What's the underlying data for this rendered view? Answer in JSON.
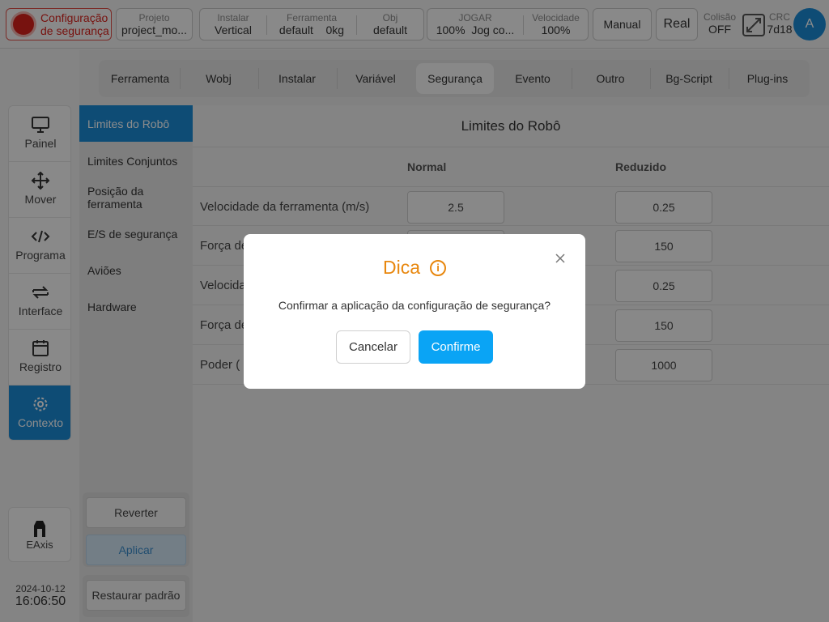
{
  "topbar": {
    "safety": {
      "line1": "Configuração",
      "line2": "de segurança"
    },
    "project": {
      "label": "Projeto",
      "value": "project_mo..."
    },
    "install": {
      "label": "Instalar",
      "value": "Vertical"
    },
    "tool": {
      "label": "Ferramenta",
      "name": "default",
      "weight": "0kg"
    },
    "obj": {
      "label": "Obj",
      "value": "default"
    },
    "jog": {
      "label": "JOGAR",
      "percent": "100%",
      "mode": "Jog co..."
    },
    "speed": {
      "label": "Velocidade",
      "value": "100%"
    },
    "manual_label": "Manual",
    "real_label": "Real",
    "collision": {
      "label": "Colisão",
      "value": "OFF"
    },
    "crc": {
      "label": "CRC",
      "value": "7d18"
    },
    "avatar_letter": "A"
  },
  "leftnav": {
    "items": [
      {
        "label": "Painel",
        "icon": "monitor-icon"
      },
      {
        "label": "Mover",
        "icon": "move-arrows-icon"
      },
      {
        "label": "Programa",
        "icon": "code-icon"
      },
      {
        "label": "Interface",
        "icon": "swap-arrows-icon"
      },
      {
        "label": "Registro",
        "icon": "calendar-icon"
      },
      {
        "label": "Contexto",
        "icon": "gear-icon",
        "active": true
      }
    ],
    "eaxis_label": "EAxis"
  },
  "datetime": {
    "date": "2024-10-12",
    "time": "16:06:50"
  },
  "tabs": [
    "Ferramenta",
    "Wobj",
    "Instalar",
    "Variável",
    "Segurança",
    "Evento",
    "Outro",
    "Bg-Script",
    "Plug-ins"
  ],
  "active_tab": "Segurança",
  "submenu": {
    "items": [
      "Limites do Robô",
      "Limites Conjuntos",
      "Posição da ferramenta",
      "E/S de segurança",
      "Aviões",
      "Hardware"
    ],
    "revert_label": "Reverter",
    "apply_label": "Aplicar",
    "restore_label": "Restaurar padrão"
  },
  "main": {
    "title": "Limites do Robô",
    "col_normal": "Normal",
    "col_reduced": "Reduzido",
    "rows": [
      {
        "label": "Velocidade da ferramenta  (m/s)",
        "normal": "2.5",
        "reduced": "0.25"
      },
      {
        "label": "Força de",
        "normal": "",
        "reduced": "150"
      },
      {
        "label": "Velocida",
        "normal": "",
        "reduced": "0.25"
      },
      {
        "label": "Força de",
        "normal": "",
        "reduced": "150"
      },
      {
        "label": "Poder  (",
        "normal": "",
        "reduced": "1000"
      }
    ]
  },
  "dialog": {
    "title": "Dica",
    "message": "Confirmar a aplicação da configuração de segurança?",
    "cancel_label": "Cancelar",
    "confirm_label": "Confirme"
  }
}
